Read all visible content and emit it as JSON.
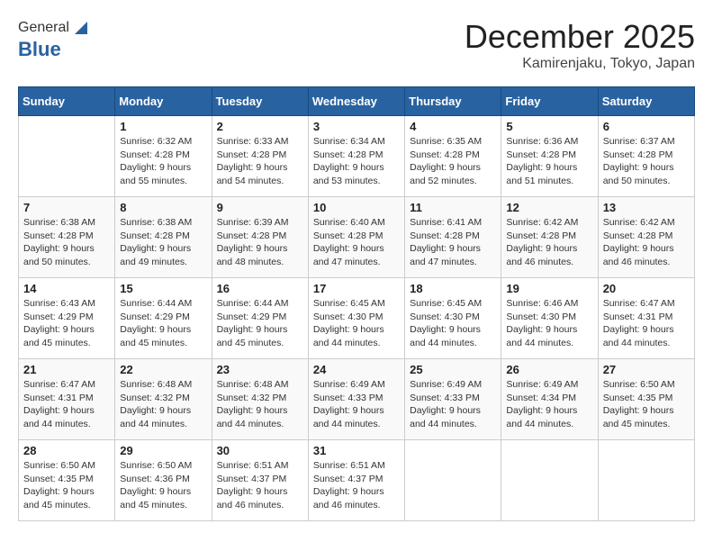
{
  "header": {
    "logo_general": "General",
    "logo_blue": "Blue",
    "month_title": "December 2025",
    "location": "Kamirenjaku, Tokyo, Japan"
  },
  "days_of_week": [
    "Sunday",
    "Monday",
    "Tuesday",
    "Wednesday",
    "Thursday",
    "Friday",
    "Saturday"
  ],
  "weeks": [
    [
      {
        "day": "",
        "sunrise": "",
        "sunset": "",
        "daylight": ""
      },
      {
        "day": "1",
        "sunrise": "Sunrise: 6:32 AM",
        "sunset": "Sunset: 4:28 PM",
        "daylight": "Daylight: 9 hours and 55 minutes."
      },
      {
        "day": "2",
        "sunrise": "Sunrise: 6:33 AM",
        "sunset": "Sunset: 4:28 PM",
        "daylight": "Daylight: 9 hours and 54 minutes."
      },
      {
        "day": "3",
        "sunrise": "Sunrise: 6:34 AM",
        "sunset": "Sunset: 4:28 PM",
        "daylight": "Daylight: 9 hours and 53 minutes."
      },
      {
        "day": "4",
        "sunrise": "Sunrise: 6:35 AM",
        "sunset": "Sunset: 4:28 PM",
        "daylight": "Daylight: 9 hours and 52 minutes."
      },
      {
        "day": "5",
        "sunrise": "Sunrise: 6:36 AM",
        "sunset": "Sunset: 4:28 PM",
        "daylight": "Daylight: 9 hours and 51 minutes."
      },
      {
        "day": "6",
        "sunrise": "Sunrise: 6:37 AM",
        "sunset": "Sunset: 4:28 PM",
        "daylight": "Daylight: 9 hours and 50 minutes."
      }
    ],
    [
      {
        "day": "7",
        "sunrise": "Sunrise: 6:38 AM",
        "sunset": "Sunset: 4:28 PM",
        "daylight": "Daylight: 9 hours and 50 minutes."
      },
      {
        "day": "8",
        "sunrise": "Sunrise: 6:38 AM",
        "sunset": "Sunset: 4:28 PM",
        "daylight": "Daylight: 9 hours and 49 minutes."
      },
      {
        "day": "9",
        "sunrise": "Sunrise: 6:39 AM",
        "sunset": "Sunset: 4:28 PM",
        "daylight": "Daylight: 9 hours and 48 minutes."
      },
      {
        "day": "10",
        "sunrise": "Sunrise: 6:40 AM",
        "sunset": "Sunset: 4:28 PM",
        "daylight": "Daylight: 9 hours and 47 minutes."
      },
      {
        "day": "11",
        "sunrise": "Sunrise: 6:41 AM",
        "sunset": "Sunset: 4:28 PM",
        "daylight": "Daylight: 9 hours and 47 minutes."
      },
      {
        "day": "12",
        "sunrise": "Sunrise: 6:42 AM",
        "sunset": "Sunset: 4:28 PM",
        "daylight": "Daylight: 9 hours and 46 minutes."
      },
      {
        "day": "13",
        "sunrise": "Sunrise: 6:42 AM",
        "sunset": "Sunset: 4:28 PM",
        "daylight": "Daylight: 9 hours and 46 minutes."
      }
    ],
    [
      {
        "day": "14",
        "sunrise": "Sunrise: 6:43 AM",
        "sunset": "Sunset: 4:29 PM",
        "daylight": "Daylight: 9 hours and 45 minutes."
      },
      {
        "day": "15",
        "sunrise": "Sunrise: 6:44 AM",
        "sunset": "Sunset: 4:29 PM",
        "daylight": "Daylight: 9 hours and 45 minutes."
      },
      {
        "day": "16",
        "sunrise": "Sunrise: 6:44 AM",
        "sunset": "Sunset: 4:29 PM",
        "daylight": "Daylight: 9 hours and 45 minutes."
      },
      {
        "day": "17",
        "sunrise": "Sunrise: 6:45 AM",
        "sunset": "Sunset: 4:30 PM",
        "daylight": "Daylight: 9 hours and 44 minutes."
      },
      {
        "day": "18",
        "sunrise": "Sunrise: 6:45 AM",
        "sunset": "Sunset: 4:30 PM",
        "daylight": "Daylight: 9 hours and 44 minutes."
      },
      {
        "day": "19",
        "sunrise": "Sunrise: 6:46 AM",
        "sunset": "Sunset: 4:30 PM",
        "daylight": "Daylight: 9 hours and 44 minutes."
      },
      {
        "day": "20",
        "sunrise": "Sunrise: 6:47 AM",
        "sunset": "Sunset: 4:31 PM",
        "daylight": "Daylight: 9 hours and 44 minutes."
      }
    ],
    [
      {
        "day": "21",
        "sunrise": "Sunrise: 6:47 AM",
        "sunset": "Sunset: 4:31 PM",
        "daylight": "Daylight: 9 hours and 44 minutes."
      },
      {
        "day": "22",
        "sunrise": "Sunrise: 6:48 AM",
        "sunset": "Sunset: 4:32 PM",
        "daylight": "Daylight: 9 hours and 44 minutes."
      },
      {
        "day": "23",
        "sunrise": "Sunrise: 6:48 AM",
        "sunset": "Sunset: 4:32 PM",
        "daylight": "Daylight: 9 hours and 44 minutes."
      },
      {
        "day": "24",
        "sunrise": "Sunrise: 6:49 AM",
        "sunset": "Sunset: 4:33 PM",
        "daylight": "Daylight: 9 hours and 44 minutes."
      },
      {
        "day": "25",
        "sunrise": "Sunrise: 6:49 AM",
        "sunset": "Sunset: 4:33 PM",
        "daylight": "Daylight: 9 hours and 44 minutes."
      },
      {
        "day": "26",
        "sunrise": "Sunrise: 6:49 AM",
        "sunset": "Sunset: 4:34 PM",
        "daylight": "Daylight: 9 hours and 44 minutes."
      },
      {
        "day": "27",
        "sunrise": "Sunrise: 6:50 AM",
        "sunset": "Sunset: 4:35 PM",
        "daylight": "Daylight: 9 hours and 45 minutes."
      }
    ],
    [
      {
        "day": "28",
        "sunrise": "Sunrise: 6:50 AM",
        "sunset": "Sunset: 4:35 PM",
        "daylight": "Daylight: 9 hours and 45 minutes."
      },
      {
        "day": "29",
        "sunrise": "Sunrise: 6:50 AM",
        "sunset": "Sunset: 4:36 PM",
        "daylight": "Daylight: 9 hours and 45 minutes."
      },
      {
        "day": "30",
        "sunrise": "Sunrise: 6:51 AM",
        "sunset": "Sunset: 4:37 PM",
        "daylight": "Daylight: 9 hours and 46 minutes."
      },
      {
        "day": "31",
        "sunrise": "Sunrise: 6:51 AM",
        "sunset": "Sunset: 4:37 PM",
        "daylight": "Daylight: 9 hours and 46 minutes."
      },
      {
        "day": "",
        "sunrise": "",
        "sunset": "",
        "daylight": ""
      },
      {
        "day": "",
        "sunrise": "",
        "sunset": "",
        "daylight": ""
      },
      {
        "day": "",
        "sunrise": "",
        "sunset": "",
        "daylight": ""
      }
    ]
  ]
}
